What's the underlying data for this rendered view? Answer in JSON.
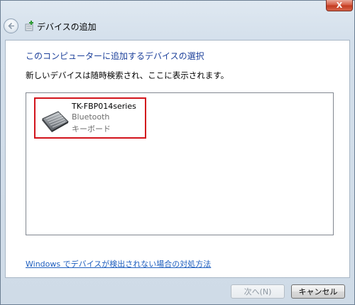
{
  "window": {
    "close_label": "X"
  },
  "titlebar": {
    "title": "デバイスの追加"
  },
  "content": {
    "heading": "このコンピューターに追加するデバイスの選択",
    "instruction": "新しいデバイスは随時検索され、ここに表示されます。",
    "devices": [
      {
        "name": "TK-FBP014series",
        "connection": "Bluetooth",
        "category": "キーボード",
        "icon": "keyboard-icon"
      }
    ],
    "help_link": "Windows でデバイスが検出されない場合の対処方法"
  },
  "footer": {
    "next_label": "次へ(N)",
    "cancel_label": "キャンセル"
  },
  "colors": {
    "heading": "#1b3f9a",
    "link": "#1f5fbf",
    "selection_border": "#d2141c",
    "close": "#c23a1f"
  }
}
